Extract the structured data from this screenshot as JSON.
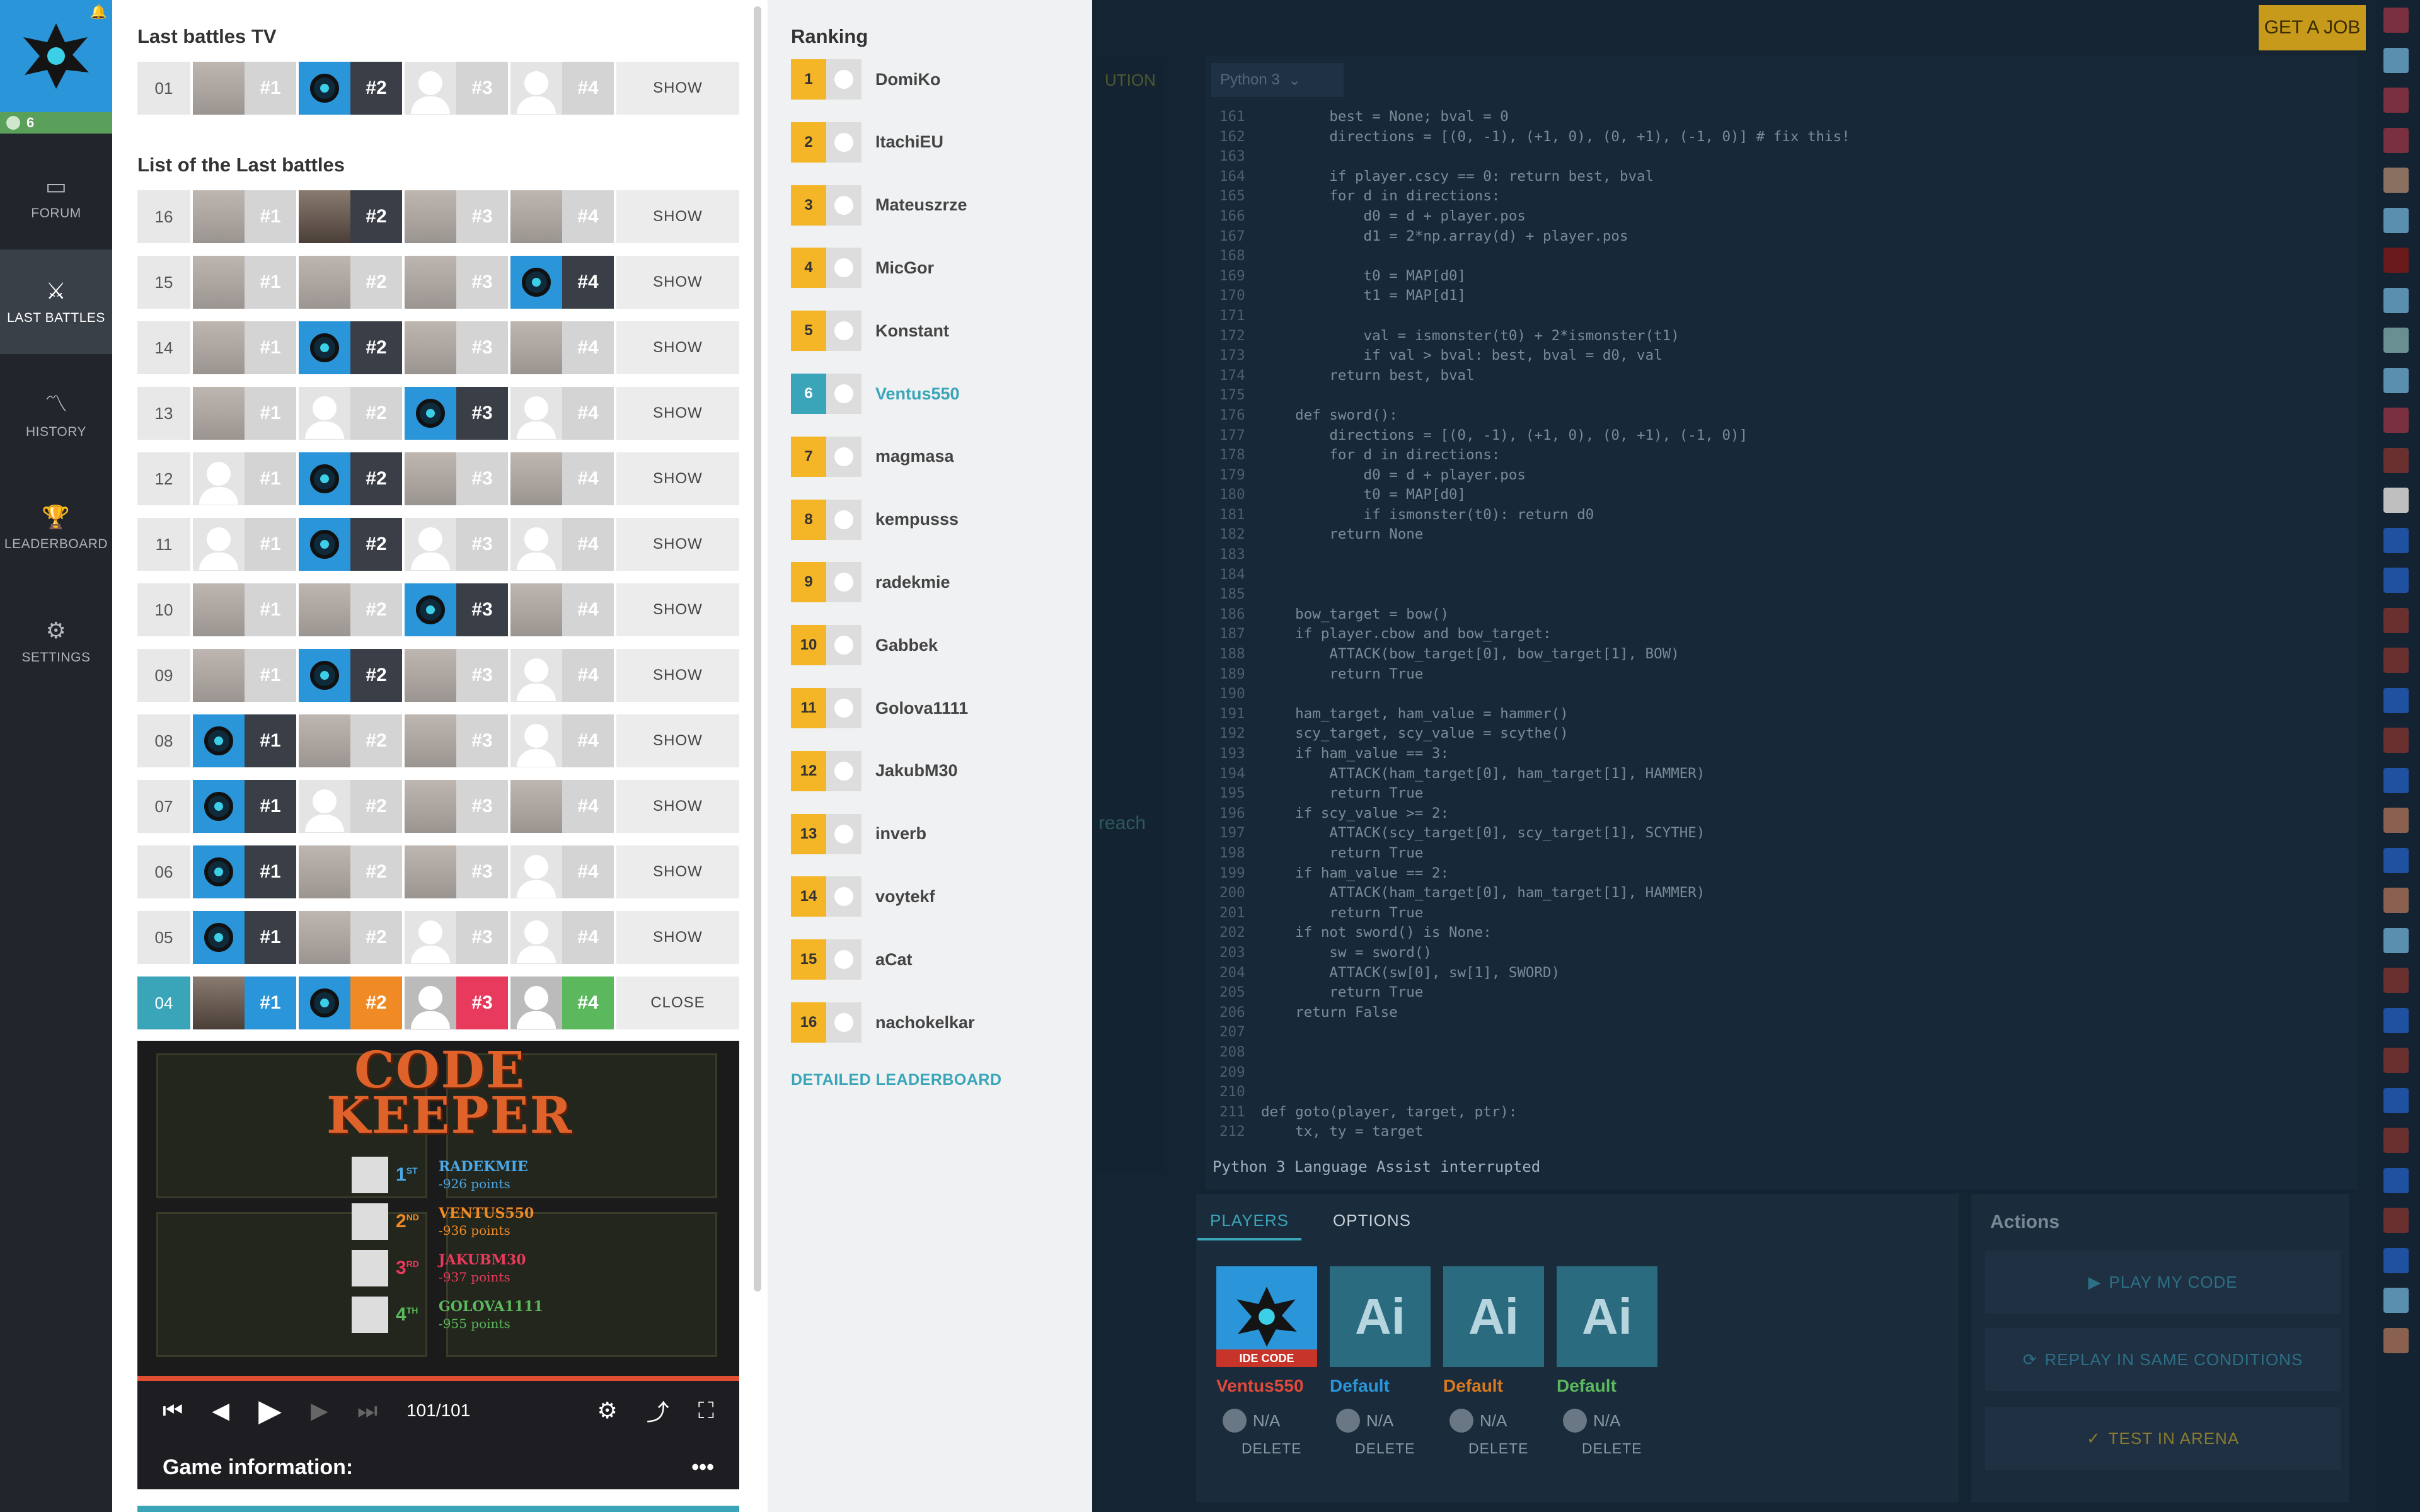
{
  "nav": {
    "level_count": "6",
    "items": [
      {
        "label": "FORUM",
        "icon": "forum-icon"
      },
      {
        "label": "LAST BATTLES",
        "icon": "last-battles-icon"
      },
      {
        "label": "HISTORY",
        "icon": "history-icon"
      },
      {
        "label": "LEADERBOARD",
        "icon": "trophy-icon"
      },
      {
        "label": "SETTINGS",
        "icon": "gear-icon"
      }
    ]
  },
  "battles": {
    "tv_heading": "Last battles TV",
    "list_heading": "List of the Last battles",
    "tv_row": {
      "num": "01",
      "ranks": [
        "#1",
        "#2",
        "#3",
        "#4"
      ],
      "winner": 1,
      "action": "SHOW"
    },
    "rows": [
      {
        "num": "16",
        "ranks": [
          "#1",
          "#2",
          "#3",
          "#4"
        ],
        "winner": 1,
        "action": "SHOW"
      },
      {
        "num": "15",
        "ranks": [
          "#1",
          "#2",
          "#3",
          "#4"
        ],
        "winner": 3,
        "action": "SHOW"
      },
      {
        "num": "14",
        "ranks": [
          "#1",
          "#2",
          "#3",
          "#4"
        ],
        "winner": 1,
        "action": "SHOW"
      },
      {
        "num": "13",
        "ranks": [
          "#1",
          "#2",
          "#3",
          "#4"
        ],
        "winner": 2,
        "action": "SHOW"
      },
      {
        "num": "12",
        "ranks": [
          "#1",
          "#2",
          "#3",
          "#4"
        ],
        "winner": 1,
        "action": "SHOW"
      },
      {
        "num": "11",
        "ranks": [
          "#1",
          "#2",
          "#3",
          "#4"
        ],
        "winner": 1,
        "action": "SHOW"
      },
      {
        "num": "10",
        "ranks": [
          "#1",
          "#2",
          "#3",
          "#4"
        ],
        "winner": 2,
        "action": "SHOW"
      },
      {
        "num": "09",
        "ranks": [
          "#1",
          "#2",
          "#3",
          "#4"
        ],
        "winner": 1,
        "action": "SHOW"
      },
      {
        "num": "08",
        "ranks": [
          "#1",
          "#2",
          "#3",
          "#4"
        ],
        "winner": 0,
        "action": "SHOW"
      },
      {
        "num": "07",
        "ranks": [
          "#1",
          "#2",
          "#3",
          "#4"
        ],
        "winner": 0,
        "action": "SHOW"
      },
      {
        "num": "06",
        "ranks": [
          "#1",
          "#2",
          "#3",
          "#4"
        ],
        "winner": 0,
        "action": "SHOW"
      },
      {
        "num": "05",
        "ranks": [
          "#1",
          "#2",
          "#3",
          "#4"
        ],
        "winner": 0,
        "action": "SHOW"
      }
    ],
    "open_row": {
      "num": "04",
      "ranks": [
        "#1",
        "#2",
        "#3",
        "#4"
      ],
      "action": "CLOSE",
      "rank_colors": [
        "#2a95d8",
        "#f08a24",
        "#e83a5c",
        "#5cb85c"
      ]
    },
    "video": {
      "title_line1": "CODE",
      "title_line2": "KEEPER",
      "results": [
        {
          "place": "1",
          "suffix": "ST",
          "name": "RADEKMIE",
          "points": "-926 points",
          "color": "#4aa8e8"
        },
        {
          "place": "2",
          "suffix": "ND",
          "name": "VENTUS550",
          "points": "-936 points",
          "color": "#f08a24"
        },
        {
          "place": "3",
          "suffix": "RD",
          "name": "JAKUBM30",
          "points": "-937 points",
          "color": "#e83a5c"
        },
        {
          "place": "4",
          "suffix": "TH",
          "name": "GOLOVA1111",
          "points": "-955 points",
          "color": "#5cb85c"
        }
      ],
      "frame_counter": "101/101",
      "info_label": "Game information:"
    }
  },
  "ranking": {
    "heading": "Ranking",
    "entries": [
      {
        "rank": "1",
        "name": "DomiKo"
      },
      {
        "rank": "2",
        "name": "ItachiEU"
      },
      {
        "rank": "3",
        "name": "Mateuszrze"
      },
      {
        "rank": "4",
        "name": "MicGor"
      },
      {
        "rank": "5",
        "name": "Konstant"
      },
      {
        "rank": "6",
        "name": "Ventus550"
      },
      {
        "rank": "7",
        "name": "magmasa"
      },
      {
        "rank": "8",
        "name": "kempusss"
      },
      {
        "rank": "9",
        "name": "radekmie"
      },
      {
        "rank": "10",
        "name": "Gabbek"
      },
      {
        "rank": "11",
        "name": "Golova1111"
      },
      {
        "rank": "12",
        "name": "JakubM30"
      },
      {
        "rank": "13",
        "name": "inverb"
      },
      {
        "rank": "14",
        "name": "voytekf"
      },
      {
        "rank": "15",
        "name": "aCat"
      },
      {
        "rank": "16",
        "name": "nachokelkar"
      }
    ],
    "highlighted_rank": "6",
    "detailed_link": "DETAILED LEADERBOARD"
  },
  "editor": {
    "get_job": "GET A JOB",
    "language": "Python 3",
    "side_label": "UTION",
    "reach_label": "reach",
    "status": "Python 3 Language Assist interrupted",
    "lines": [
      {
        "n": "161",
        "t": "        best = None; bval = 0"
      },
      {
        "n": "162",
        "t": "        directions = [(0, -1), (+1, 0), (0, +1), (-1, 0)] # fix this!"
      },
      {
        "n": "163",
        "t": ""
      },
      {
        "n": "164",
        "t": "        if player.cscy == 0: return best, bval"
      },
      {
        "n": "165",
        "t": "        for d in directions:"
      },
      {
        "n": "166",
        "t": "            d0 = d + player.pos"
      },
      {
        "n": "167",
        "t": "            d1 = 2*np.array(d) + player.pos"
      },
      {
        "n": "168",
        "t": ""
      },
      {
        "n": "169",
        "t": "            t0 = MAP[d0]"
      },
      {
        "n": "170",
        "t": "            t1 = MAP[d1]"
      },
      {
        "n": "171",
        "t": ""
      },
      {
        "n": "172",
        "t": "            val = ismonster(t0) + 2*ismonster(t1)"
      },
      {
        "n": "173",
        "t": "            if val > bval: best, bval = d0, val"
      },
      {
        "n": "174",
        "t": "        return best, bval"
      },
      {
        "n": "175",
        "t": ""
      },
      {
        "n": "176",
        "t": "    def sword():"
      },
      {
        "n": "177",
        "t": "        directions = [(0, -1), (+1, 0), (0, +1), (-1, 0)]"
      },
      {
        "n": "178",
        "t": "        for d in directions:"
      },
      {
        "n": "179",
        "t": "            d0 = d + player.pos"
      },
      {
        "n": "180",
        "t": "            t0 = MAP[d0]"
      },
      {
        "n": "181",
        "t": "            if ismonster(t0): return d0"
      },
      {
        "n": "182",
        "t": "        return None"
      },
      {
        "n": "183",
        "t": ""
      },
      {
        "n": "184",
        "t": ""
      },
      {
        "n": "185",
        "t": ""
      },
      {
        "n": "186",
        "t": "    bow_target = bow()"
      },
      {
        "n": "187",
        "t": "    if player.cbow and bow_target:"
      },
      {
        "n": "188",
        "t": "        ATTACK(bow_target[0], bow_target[1], BOW)"
      },
      {
        "n": "189",
        "t": "        return True"
      },
      {
        "n": "190",
        "t": ""
      },
      {
        "n": "191",
        "t": "    ham_target, ham_value = hammer()"
      },
      {
        "n": "192",
        "t": "    scy_target, scy_value = scythe()"
      },
      {
        "n": "193",
        "t": "    if ham_value == 3:"
      },
      {
        "n": "194",
        "t": "        ATTACK(ham_target[0], ham_target[1], HAMMER)"
      },
      {
        "n": "195",
        "t": "        return True"
      },
      {
        "n": "196",
        "t": "    if scy_value >= 2:"
      },
      {
        "n": "197",
        "t": "        ATTACK(scy_target[0], scy_target[1], SCYTHE)"
      },
      {
        "n": "198",
        "t": "        return True"
      },
      {
        "n": "199",
        "t": "    if ham_value == 2:"
      },
      {
        "n": "200",
        "t": "        ATTACK(ham_target[0], ham_target[1], HAMMER)"
      },
      {
        "n": "201",
        "t": "        return True"
      },
      {
        "n": "202",
        "t": "    if not sword() is None:"
      },
      {
        "n": "203",
        "t": "        sw = sword()"
      },
      {
        "n": "204",
        "t": "        ATTACK(sw[0], sw[1], SWORD)"
      },
      {
        "n": "205",
        "t": "        return True"
      },
      {
        "n": "206",
        "t": "    return False"
      },
      {
        "n": "207",
        "t": ""
      },
      {
        "n": "208",
        "t": ""
      },
      {
        "n": "209",
        "t": ""
      },
      {
        "n": "210",
        "t": ""
      },
      {
        "n": "211",
        "t": "def goto(player, target, ptr):"
      },
      {
        "n": "212",
        "t": "    tx, ty = target"
      }
    ]
  },
  "players_panel": {
    "tab_players": "PLAYERS",
    "tab_options": "OPTIONS",
    "players": [
      {
        "name": "Ventus550",
        "tag": "IDE CODE",
        "score": "N/A",
        "delete": "DELETE",
        "color": "#e04a3a"
      },
      {
        "name": "Default",
        "tag": "",
        "score": "N/A",
        "delete": "DELETE",
        "color": "#2a95d8",
        "card_text": "Ai"
      },
      {
        "name": "Default",
        "tag": "",
        "score": "N/A",
        "delete": "DELETE",
        "color": "#d97a20",
        "card_text": "Ai"
      },
      {
        "name": "Default",
        "tag": "",
        "score": "N/A",
        "delete": "DELETE",
        "color": "#5cb85c",
        "card_text": "Ai"
      }
    ]
  },
  "actions": {
    "heading": "Actions",
    "play": "PLAY MY CODE",
    "replay": "REPLAY IN SAME CONDITIONS",
    "test": "TEST IN ARENA"
  }
}
